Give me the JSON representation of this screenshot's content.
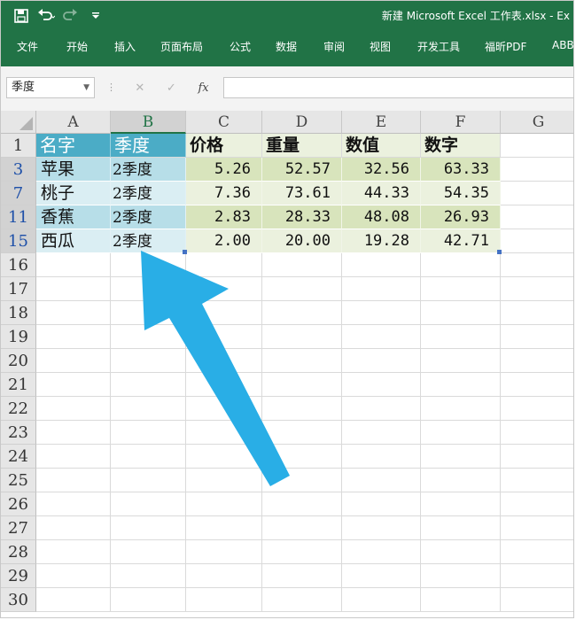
{
  "app": {
    "title": "新建 Microsoft Excel 工作表.xlsx  -  Ex",
    "accent": "#217346"
  },
  "qat": {
    "save_icon": "save-icon",
    "undo_icon": "undo-icon",
    "redo_icon": "redo-icon",
    "customize_icon": "customize-qat-icon"
  },
  "ribbon": {
    "tabs": [
      "文件",
      "开始",
      "插入",
      "页面布局",
      "公式",
      "数据",
      "审阅",
      "视图",
      "开发工具",
      "福昕PDF",
      "ABB"
    ]
  },
  "formula_bar": {
    "name_box_value": "季度",
    "cancel_glyph": "✕",
    "enter_glyph": "✓",
    "fx_label": "fx",
    "formula_value": ""
  },
  "sheet": {
    "columns": [
      "A",
      "B",
      "C",
      "D",
      "E",
      "F",
      "G"
    ],
    "rows": [
      "1",
      "3",
      "7",
      "11",
      "15",
      "16",
      "17",
      "18",
      "19",
      "20",
      "21",
      "22",
      "23",
      "24",
      "25",
      "26",
      "27",
      "28",
      "29",
      "30"
    ],
    "header_row": [
      "名字",
      "季度",
      "价格",
      "重量",
      "数值",
      "数字"
    ],
    "data_rows": [
      [
        "苹果",
        "2季度",
        "5.26",
        "52.57",
        "32.56",
        "63.33"
      ],
      [
        "桃子",
        "2季度",
        "7.36",
        "73.61",
        "44.33",
        "54.35"
      ],
      [
        "香蕉",
        "2季度",
        "2.83",
        "28.33",
        "48.08",
        "26.93"
      ],
      [
        "西瓜",
        "2季度",
        "2.00",
        "20.00",
        "19.28",
        "42.71"
      ]
    ],
    "colors": {
      "header_ab_fill": "#4bacc6",
      "ab_dark_fill": "#b7dee8",
      "ab_light_fill": "#daeef3",
      "cf_header_fill": "#ebf1de",
      "cf_dark_fill": "#d8e4bc",
      "cf_light_fill": "#ebf1de"
    }
  },
  "overlay": {
    "arrow_icon": "arrow-up-left-icon",
    "arrow_color": "#29aee6"
  }
}
